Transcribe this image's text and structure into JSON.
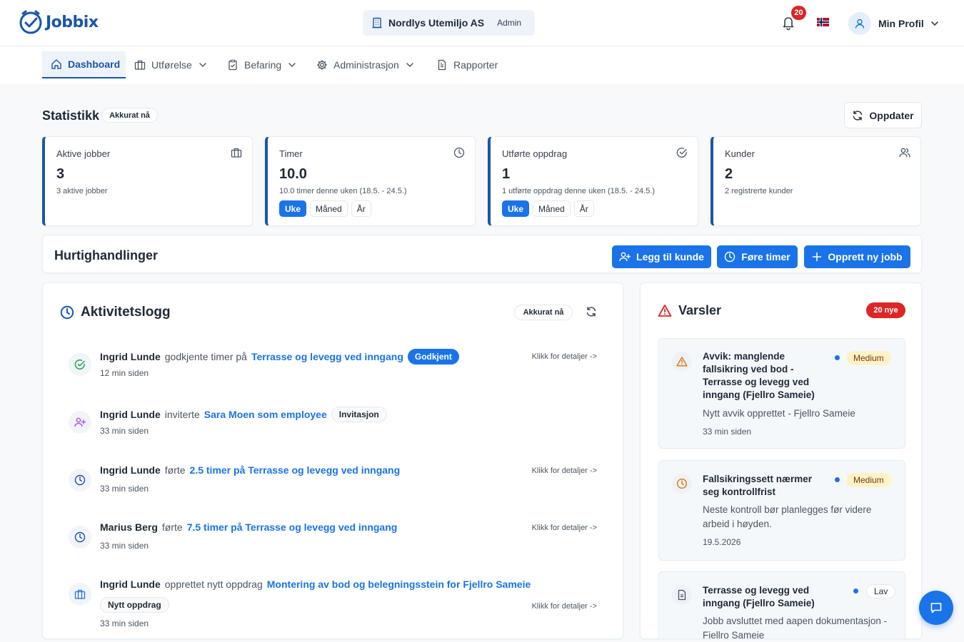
{
  "brand": {
    "name": "Jobbix",
    "color": "#1a56a7",
    "accent": "#1a73e8"
  },
  "header": {
    "company": "Nordlys Utemiljo AS",
    "role": "Admin",
    "notifications": "20",
    "language_flag": "norway-flag",
    "profile_label": "Min Profil"
  },
  "nav": {
    "items": [
      {
        "label": "Dashboard",
        "icon": "home-icon",
        "active": true
      },
      {
        "label": "Utførelse",
        "icon": "briefcase-icon",
        "dropdown": true
      },
      {
        "label": "Befaring",
        "icon": "clipboard-icon",
        "dropdown": true
      },
      {
        "label": "Administrasjon",
        "icon": "gear-icon",
        "dropdown": true
      },
      {
        "label": "Rapporter",
        "icon": "document-icon"
      }
    ]
  },
  "stats": {
    "title": "Statistikk",
    "updated": "Akkurat nå",
    "refresh_label": "Oppdater",
    "cards": [
      {
        "label": "Aktive jobber",
        "value": "3",
        "sub": "3 aktive jobber",
        "icon": "briefcase-icon"
      },
      {
        "label": "Timer",
        "value": "10.0",
        "sub": "10.0 timer denne uken (18.5. - 24.5.)",
        "icon": "clock-icon"
      },
      {
        "label": "Utførte oppdrag",
        "value": "1",
        "sub": "1 utførte oppdrag denne uken (18.5. - 24.5.)",
        "icon": "check-circle-icon"
      },
      {
        "label": "Kunder",
        "value": "2",
        "sub": "2 registrerte kunder",
        "icon": "users-icon"
      }
    ],
    "period": {
      "week": "Uke",
      "month": "Måned",
      "year": "År",
      "selected": "Uke"
    }
  },
  "quick": {
    "title": "Hurtighandlinger",
    "add_customer": "Legg til kunde",
    "log_hours": "Føre timer",
    "new_job": "Opprett ny jobb"
  },
  "activity": {
    "title": "Aktivitetslogg",
    "updated": "Akkurat nå",
    "details_label": "Klikk for detaljer ->",
    "rows": [
      {
        "user": "Ingrid Lunde",
        "action": "godkjente timer på",
        "link": "Terrasse og levegg ved inngang",
        "tag": "Godkjent",
        "time": "12 min siden",
        "icon": "check-circle-icon"
      },
      {
        "user": "Ingrid Lunde",
        "action": "inviterte",
        "link": "Sara Moen som employee",
        "tag": "Invitasjon",
        "time": "33 min siden",
        "icon": "user-plus-icon"
      },
      {
        "user": "Ingrid Lunde",
        "action": "førte",
        "link": "2.5 timer på Terrasse og levegg ved inngang",
        "time": "33 min siden",
        "icon": "clock-icon"
      },
      {
        "user": "Marius Berg",
        "action": "førte",
        "link": "7.5 timer på Terrasse og levegg ved inngang",
        "time": "33 min siden",
        "icon": "clock-icon"
      },
      {
        "user": "Ingrid Lunde",
        "action": "opprettet nytt oppdrag",
        "link": "Montering av bod og belegningsstein for Fjellro Sameie",
        "tag": "Nytt oppdrag",
        "time": "33 min siden",
        "icon": "briefcase-icon"
      }
    ]
  },
  "alerts": {
    "title": "Varsler",
    "badge": "20 nye",
    "items": [
      {
        "title": "Avvik: manglende fallsikring ved bod - Terrasse og levegg ved inngang (Fjellro Sameie)",
        "severity": "Medium",
        "desc": "Nytt avvik opprettet - Fjellro Sameie",
        "time": "33 min siden",
        "icon": "warning-icon"
      },
      {
        "title": "Fallsikringssett nærmer seg kontrollfrist",
        "severity": "Medium",
        "desc": "Neste kontroll bør planlegges før videre arbeid i høyden.",
        "time": "19.5.2026",
        "icon": "clock-icon"
      },
      {
        "title": "Terrasse og levegg ved inngang (Fjellro Sameie)",
        "severity": "Lav",
        "desc": "Jobb avsluttet med aapen dokumentasjon - Fjellro Sameie",
        "icon": "document-icon"
      }
    ]
  },
  "chat": {
    "icon": "chat-icon"
  }
}
